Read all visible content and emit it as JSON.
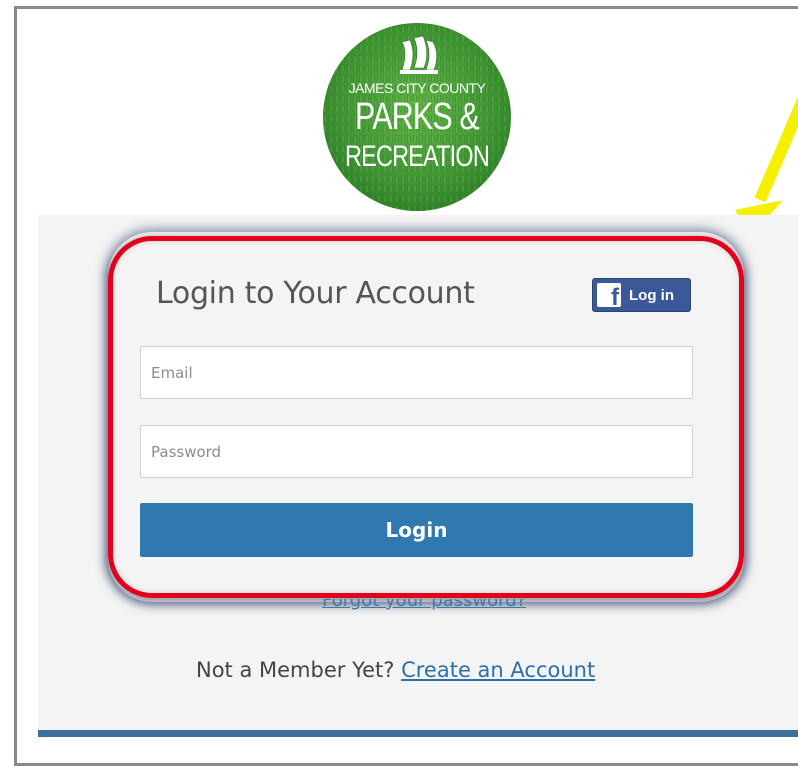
{
  "logo": {
    "line1": "JAMES CITY COUNTY",
    "line2": "PARKS &",
    "line3": "RECREATION"
  },
  "login": {
    "title": "Login to Your Account",
    "facebook_label": "Log in",
    "facebook_glyph": "f",
    "email_placeholder": "Email",
    "password_placeholder": "Password",
    "submit_label": "Login",
    "forgot_link": "Forgot your password?"
  },
  "signup": {
    "prompt": "Not a Member Yet?",
    "link": "Create an Account"
  },
  "colors": {
    "primary_button": "#2f79b0",
    "facebook": "#3b5998",
    "highlight": "#e4001b",
    "arrow": "#f5ef00"
  }
}
